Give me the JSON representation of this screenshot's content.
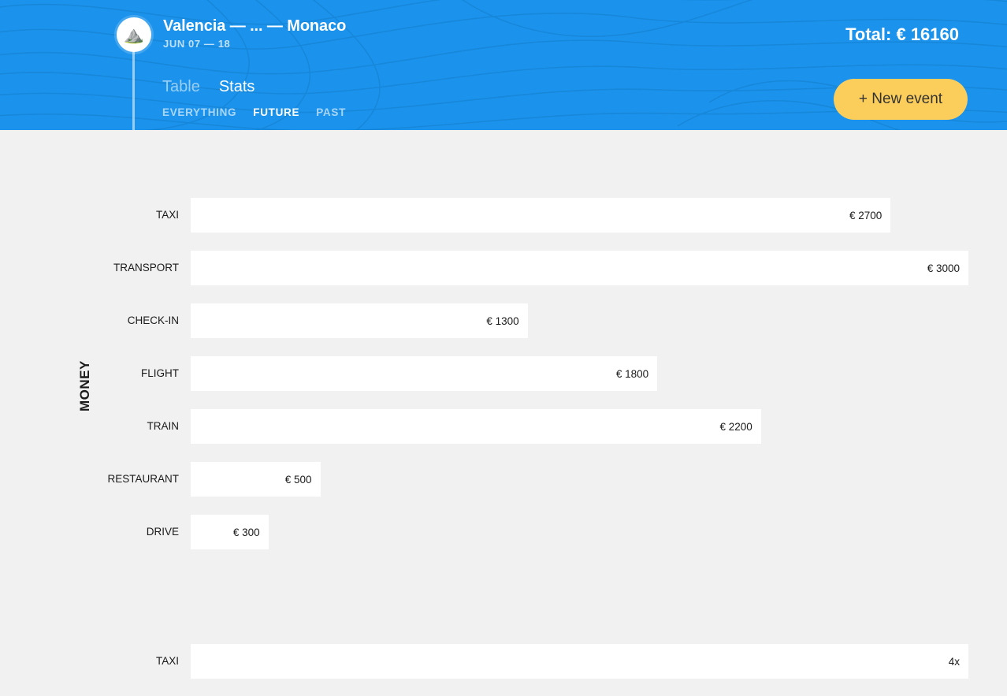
{
  "header": {
    "avatar_emoji": "⛰️",
    "trip_title": "Valencia — ... — Monaco",
    "trip_dates": "JUN 07 — 18",
    "total": "Total: € 16160",
    "new_event_label": "+ New event",
    "brand_blue": "#1b93ec",
    "accent_yellow": "#fbce5c",
    "view_tabs": [
      {
        "label": "Table",
        "active": false
      },
      {
        "label": "Stats",
        "active": true
      }
    ],
    "filter_tabs": [
      {
        "label": "EVERYTHING",
        "active": false
      },
      {
        "label": "FUTURE",
        "active": true
      },
      {
        "label": "PAST",
        "active": false
      }
    ]
  },
  "chart_data": [
    {
      "id": "money",
      "type": "bar",
      "orientation": "horizontal",
      "title": "",
      "xlabel": "",
      "ylabel": "MONEY",
      "grid": false,
      "legend": null,
      "bar_color": "#ffffff",
      "background": "#f1f1f1",
      "xlim": [
        0,
        3000
      ],
      "categories": [
        "TAXI",
        "TRANSPORT",
        "CHECK-IN",
        "FLIGHT",
        "TRAIN",
        "RESTAURANT",
        "DRIVE"
      ],
      "values": [
        2700,
        3000,
        1300,
        1800,
        2200,
        500,
        300
      ],
      "labels": [
        "€ 2700",
        "€ 3000",
        "€ 1300",
        "€ 1800",
        "€ 2200",
        "€ 500",
        "€ 300"
      ]
    },
    {
      "id": "count",
      "type": "bar",
      "orientation": "horizontal",
      "title": "",
      "xlabel": "",
      "ylabel": "",
      "grid": false,
      "legend": null,
      "bar_color": "#ffffff",
      "background": "#f1f1f1",
      "xlim": [
        0,
        4
      ],
      "categories": [
        "TAXI"
      ],
      "values": [
        4
      ],
      "labels": [
        "4x"
      ]
    }
  ]
}
